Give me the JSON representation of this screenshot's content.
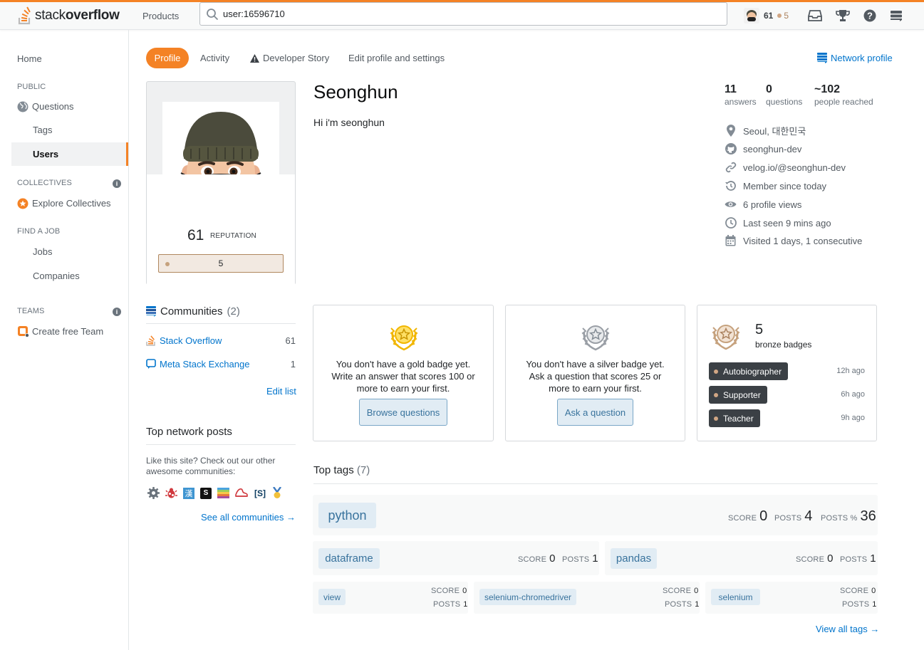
{
  "topbar": {
    "logo_text_light": "stack",
    "logo_text_bold": "overflow",
    "products_label": "Products",
    "search_value": "user:16596710",
    "reputation": "61",
    "bronze_count": "5",
    "colors": {
      "accent": "#f48225",
      "bronze": "#c6a27e"
    }
  },
  "leftnav": {
    "home": "Home",
    "public_header": "PUBLIC",
    "questions": "Questions",
    "tags": "Tags",
    "users": "Users",
    "collectives_header": "COLLECTIVES",
    "explore_collectives": "Explore Collectives",
    "find_job_header": "FIND A JOB",
    "jobs": "Jobs",
    "companies": "Companies",
    "teams_header": "TEAMS",
    "create_team": "Create free Team",
    "info_glyph": "i"
  },
  "tabs": {
    "profile": "Profile",
    "activity": "Activity",
    "developer_story": "Developer Story",
    "edit_profile": "Edit profile and settings",
    "network_profile": "Network profile"
  },
  "profile": {
    "name": "Seonghun",
    "bio": "Hi i'm seonghun",
    "reputation": "61",
    "reputation_label": "REPUTATION",
    "bronze_badges": "5"
  },
  "stats": [
    {
      "value": "11",
      "label": "answers"
    },
    {
      "value": "0",
      "label": "questions"
    },
    {
      "value": "~102",
      "label": "people reached"
    }
  ],
  "meta": [
    {
      "icon": "location-pin-icon",
      "text": "Seoul, 대한민국"
    },
    {
      "icon": "github-icon",
      "text": "seonghun-dev"
    },
    {
      "icon": "link-icon",
      "text": "velog.io/@seonghun-dev"
    },
    {
      "icon": "history-icon",
      "text": "Member since today"
    },
    {
      "icon": "eye-icon",
      "text": "6 profile views"
    },
    {
      "icon": "clock-icon",
      "text": "Last seen 9 mins ago"
    },
    {
      "icon": "calendar-icon",
      "text": "Visited 1 days, 1 consecutive"
    }
  ],
  "communities": {
    "title": "Communities",
    "count": "(2)",
    "items": [
      {
        "name": "Stack Overflow",
        "value": "61"
      },
      {
        "name": "Meta Stack Exchange",
        "value": "1"
      }
    ],
    "edit_list": "Edit list"
  },
  "top_network_posts": {
    "title": "Top network posts",
    "description": "Like this site? Check out our other awesome communities:",
    "site_icons": [
      "gear-site-icon",
      "bug-site-icon",
      "kanji-site-icon",
      "s-site-icon",
      "palette-site-icon",
      "shoe-site-icon",
      "s-bracket-site-icon",
      "medal-site-icon"
    ],
    "s_glyph": "S",
    "s_bracket_glyph": "[S]",
    "kanji_glyph": "漢",
    "see_all": "See all communities →"
  },
  "badges": {
    "gold": {
      "message": "You don't have a gold badge yet. Write an answer that scores 100 or more to earn your first.",
      "button": "Browse questions"
    },
    "silver": {
      "message": "You don't have a silver badge yet. Ask a question that scores 25 or more to earn your first.",
      "button": "Ask a question"
    },
    "bronze": {
      "count": "5",
      "label": "bronze badges",
      "items": [
        {
          "name": "Autobiographer",
          "time": "12h ago"
        },
        {
          "name": "Supporter",
          "time": "6h ago"
        },
        {
          "name": "Teacher",
          "time": "9h ago"
        }
      ]
    }
  },
  "top_tags": {
    "title": "Top tags",
    "count": "(7)",
    "labels": {
      "score": "SCORE",
      "posts": "POSTS",
      "posts_pct": "POSTS %"
    },
    "python": {
      "name": "python",
      "score": "0",
      "posts": "4",
      "posts_pct": "36"
    },
    "row2": [
      {
        "name": "dataframe",
        "score": "0",
        "posts": "1"
      },
      {
        "name": "pandas",
        "score": "0",
        "posts": "1"
      }
    ],
    "row3": [
      {
        "name": "view",
        "score": "0",
        "posts": "1"
      },
      {
        "name": "selenium-chromedriver",
        "score": "0",
        "posts": "1"
      },
      {
        "name": "selenium",
        "score": "0",
        "posts": "1"
      }
    ],
    "view_all": "View all tags →"
  }
}
